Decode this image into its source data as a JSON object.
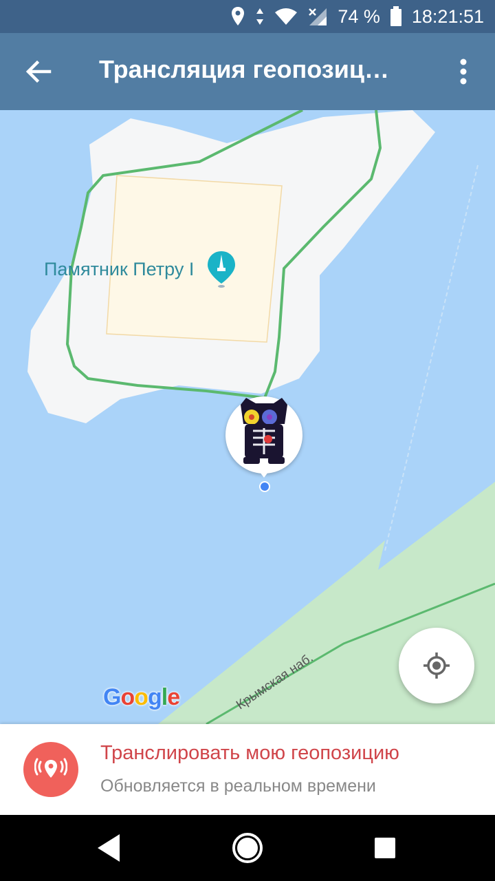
{
  "status_bar": {
    "battery_percent": "74 %",
    "time": "18:21:51",
    "icons": [
      "location-icon",
      "data-arrows-icon",
      "wifi-icon",
      "signal-icon",
      "battery-icon"
    ]
  },
  "app_bar": {
    "title": "Трансляция геопозиц…",
    "icons": [
      "back-arrow-icon",
      "more-vert-icon"
    ]
  },
  "map": {
    "poi_label": "Памятник Петру I",
    "poi_icon": "monument-pin-icon",
    "street_label": "Крымская наб.",
    "attribution": [
      "G",
      "o",
      "o",
      "g",
      "l",
      "e"
    ],
    "attribution_colors": [
      "#4285f4",
      "#ea4335",
      "#fbbc05",
      "#4285f4",
      "#34a853",
      "#ea4335"
    ],
    "user_avatar": "user-avatar",
    "my_location_icon": "my-location-icon"
  },
  "share_panel": {
    "title": "Транслировать мою геопозицию",
    "subtitle": "Обновляется в реальном времени",
    "icon": "live-location-icon",
    "accent": "#f0615b"
  },
  "nav_bar": {
    "icons": [
      "back-triangle-icon",
      "home-circle-icon",
      "recents-square-icon"
    ]
  },
  "colors": {
    "status_bar": "#3e6289",
    "app_bar": "#527da3",
    "water": "#aad3f9",
    "island": "#f5f6f7",
    "park": "#c7e8c9",
    "path": "#5bb96f",
    "plaza": "#fef8e7"
  }
}
